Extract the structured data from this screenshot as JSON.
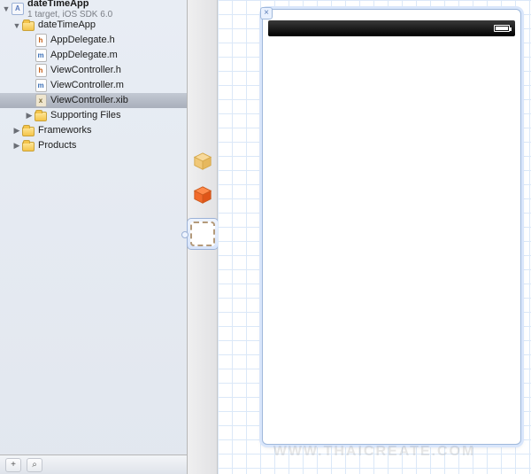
{
  "project": {
    "name": "dateTimeApp",
    "subtitle": "1 target, iOS SDK 6.0"
  },
  "tree": {
    "root_group": "dateTimeApp",
    "files": [
      {
        "name": "AppDelegate.h",
        "kind": "h"
      },
      {
        "name": "AppDelegate.m",
        "kind": "m"
      },
      {
        "name": "ViewController.h",
        "kind": "h"
      },
      {
        "name": "ViewController.m",
        "kind": "m"
      },
      {
        "name": "ViewController.xib",
        "kind": "x",
        "selected": true
      }
    ],
    "supporting_folder": "Supporting Files",
    "frameworks": "Frameworks",
    "products": "Products"
  },
  "dock": {
    "placeholder_object": "placeholder-object",
    "files_owner": "files-owner",
    "view_object": "view-object"
  },
  "footer": {
    "add": "+",
    "filter": "⌕"
  },
  "canvas": {
    "close": "×"
  },
  "watermark": "WWW.THAICREATE.COM"
}
